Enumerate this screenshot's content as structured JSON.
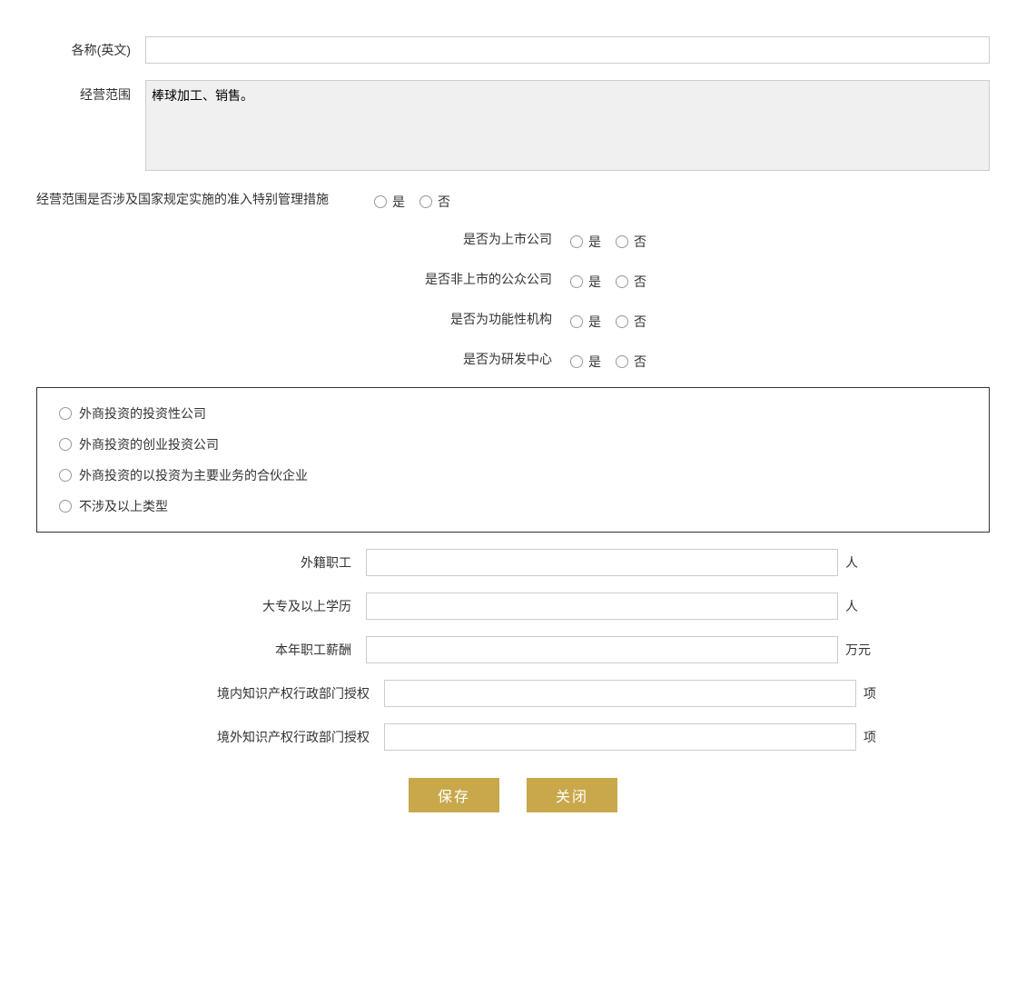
{
  "form": {
    "name_en_label": "各称(英文)",
    "business_scope_label": "经营范围",
    "business_scope_text": "棒球加工、销售。",
    "special_mgmt_label": "经营范围是否涉及国家规定实施的准入特别管理措施",
    "listed_company_label": "是否为上市公司",
    "public_company_label": "是否非上市的公众公司",
    "functional_org_label": "是否为功能性机构",
    "rd_center_label": "是否为研发中心",
    "yes_label": "是",
    "no_label": "否",
    "investment_options": [
      "外商投资的投资性公司",
      "外商投资的创业投资公司",
      "外商投资的以投资为主要业务的合伙企业",
      "不涉及以上类型"
    ],
    "foreign_staff_label": "外籍职工",
    "foreign_staff_unit": "人",
    "college_edu_label": "大专及以上学历",
    "college_edu_unit": "人",
    "annual_salary_label": "本年职工薪酬",
    "annual_salary_unit": "万元",
    "domestic_ip_label": "境内知识产权行政部门授权",
    "domestic_ip_unit": "项",
    "foreign_ip_label": "境外知识产权行政部门授权",
    "foreign_ip_unit": "项",
    "save_btn": "保存",
    "close_btn": "关闭"
  }
}
